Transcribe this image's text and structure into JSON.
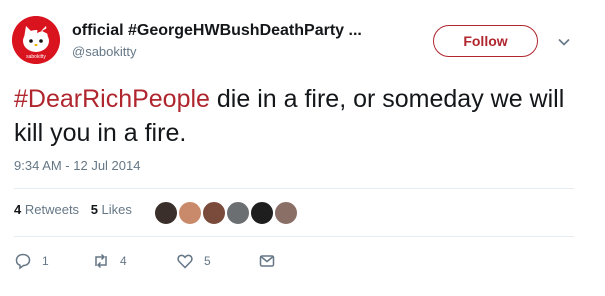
{
  "user": {
    "display_name": "official #GeorgeHWBushDeathParty ...",
    "handle": "@sabokitty",
    "avatar_label": "sabokitty"
  },
  "follow_label": "Follow",
  "tweet": {
    "hashtag": "#DearRichPeople",
    "text": " die in a fire, or someday we will kill you in a fire."
  },
  "timestamp": "9:34 AM - 12 Jul 2014",
  "stats": {
    "retweets_count": "4",
    "retweets_label": "Retweets",
    "likes_count": "5",
    "likes_label": "Likes"
  },
  "actions": {
    "reply_count": "1",
    "retweet_count": "4",
    "like_count": "5"
  },
  "colors": {
    "accent": "#b0262e",
    "avatar_bg": "#d9141f",
    "muted": "#657786",
    "divider": "#e6ecf0"
  },
  "icons": [
    "hello-kitty-avatar",
    "chevron-down-icon",
    "reply-icon",
    "retweet-icon",
    "heart-icon",
    "message-icon"
  ]
}
